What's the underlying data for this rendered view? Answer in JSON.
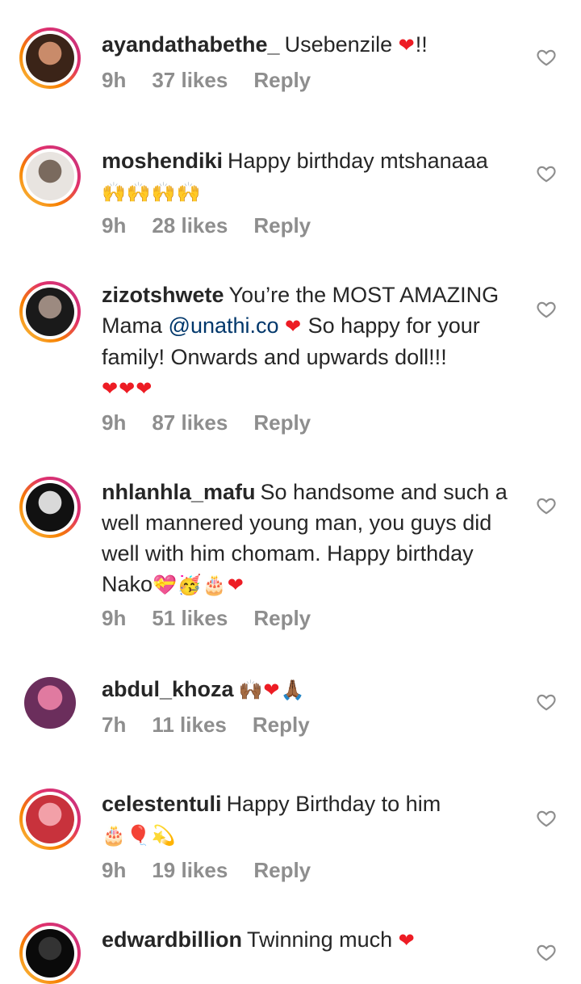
{
  "comments": [
    {
      "username": "ayandathabethe_",
      "segments": [
        {
          "t": "Usebenzile ",
          "type": "text"
        },
        {
          "t": "❤",
          "type": "heart"
        },
        {
          "t": "!!",
          "type": "text"
        }
      ],
      "time": "9h",
      "likes": "37 likes",
      "reply": "Reply",
      "avatar_colors": [
        "#3b2418",
        "#c98b6a"
      ]
    },
    {
      "username": "moshendiki",
      "segments": [
        {
          "t": "Happy birthday mtshanaaa",
          "type": "text"
        },
        {
          "t": "\n",
          "type": "br"
        },
        {
          "t": "🙌🙌🙌🙌",
          "type": "emoji"
        }
      ],
      "time": "9h",
      "likes": "28 likes",
      "reply": "Reply",
      "avatar_colors": [
        "#e8e4e0",
        "#7a6a5e"
      ]
    },
    {
      "username": "zizotshwete",
      "segments": [
        {
          "t": "You’re the MOST AMAZING Mama ",
          "type": "text"
        },
        {
          "t": "@unathi.co",
          "type": "mention"
        },
        {
          "t": " ",
          "type": "text"
        },
        {
          "t": "❤",
          "type": "heart"
        },
        {
          "t": " So happy for your family! Onwards and upwards doll!!!",
          "type": "text"
        },
        {
          "t": "\n",
          "type": "br"
        },
        {
          "t": "❤❤❤",
          "type": "heart"
        }
      ],
      "time": "9h",
      "likes": "87 likes",
      "reply": "Reply",
      "avatar_colors": [
        "#1a1a1a",
        "#9c8a80"
      ]
    },
    {
      "username": "nhlanhla_mafu",
      "segments": [
        {
          "t": "So handsome and such a well mannered young man, you guys did well with him chomam. Happy birthday Nako",
          "type": "text"
        },
        {
          "t": "💝🥳🎂",
          "type": "emoji"
        },
        {
          "t": "❤",
          "type": "heart"
        }
      ],
      "time": "9h",
      "likes": "51 likes",
      "reply": "Reply",
      "avatar_colors": [
        "#111111",
        "#d9d9d9"
      ]
    },
    {
      "username": "abdul_khoza",
      "segments": [
        {
          "t": "🙌🏾",
          "type": "emoji"
        },
        {
          "t": "❤",
          "type": "heart"
        },
        {
          "t": "🙏🏾",
          "type": "emoji"
        }
      ],
      "time": "7h",
      "likes": "11 likes",
      "reply": "Reply",
      "avatar_colors": [
        "#6b2e5c",
        "#e07aa0"
      ]
    },
    {
      "username": "celestentuli",
      "segments": [
        {
          "t": "Happy Birthday to him",
          "type": "text"
        },
        {
          "t": "\n",
          "type": "br"
        },
        {
          "t": "🎂🎈💫",
          "type": "emoji"
        }
      ],
      "time": "9h",
      "likes": "19 likes",
      "reply": "Reply",
      "avatar_colors": [
        "#c8323c",
        "#f2a0a8"
      ]
    },
    {
      "username": "edwardbillion",
      "segments": [
        {
          "t": "Twinning much ",
          "type": "text"
        },
        {
          "t": "❤",
          "type": "heart"
        }
      ],
      "time": "",
      "likes": "",
      "reply": "",
      "avatar_colors": [
        "#0a0a0a",
        "#333333"
      ]
    }
  ],
  "colors": {
    "meta_gray": "#8e8e8e",
    "heart": "#ed1c24",
    "mention": "#00376b"
  },
  "icons": {
    "like": "heart-outline-icon"
  }
}
